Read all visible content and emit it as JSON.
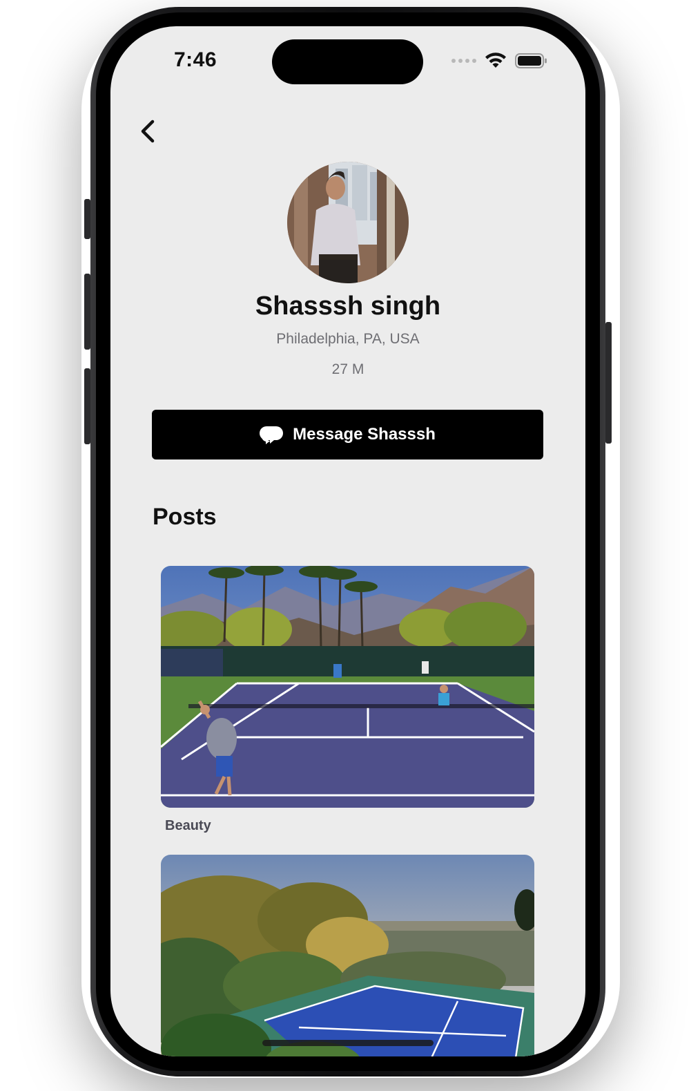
{
  "status_bar": {
    "time": "7:46"
  },
  "profile": {
    "name": "Shasssh singh",
    "location": "Philadelphia, PA, USA",
    "age_sex": "27 M",
    "message_button_label": "Message Shasssh"
  },
  "posts": {
    "title": "Posts",
    "items": [
      {
        "caption": "Beauty",
        "image": "tennis-court-desert-palms-photo"
      },
      {
        "caption": "",
        "image": "tennis-court-hillside-view-photo"
      }
    ]
  },
  "icons": {
    "back": "chevron-left-icon",
    "message": "chat-bubbles-icon",
    "wifi": "wifi-icon",
    "battery": "battery-icon",
    "signal": "signal-dots-icon"
  }
}
